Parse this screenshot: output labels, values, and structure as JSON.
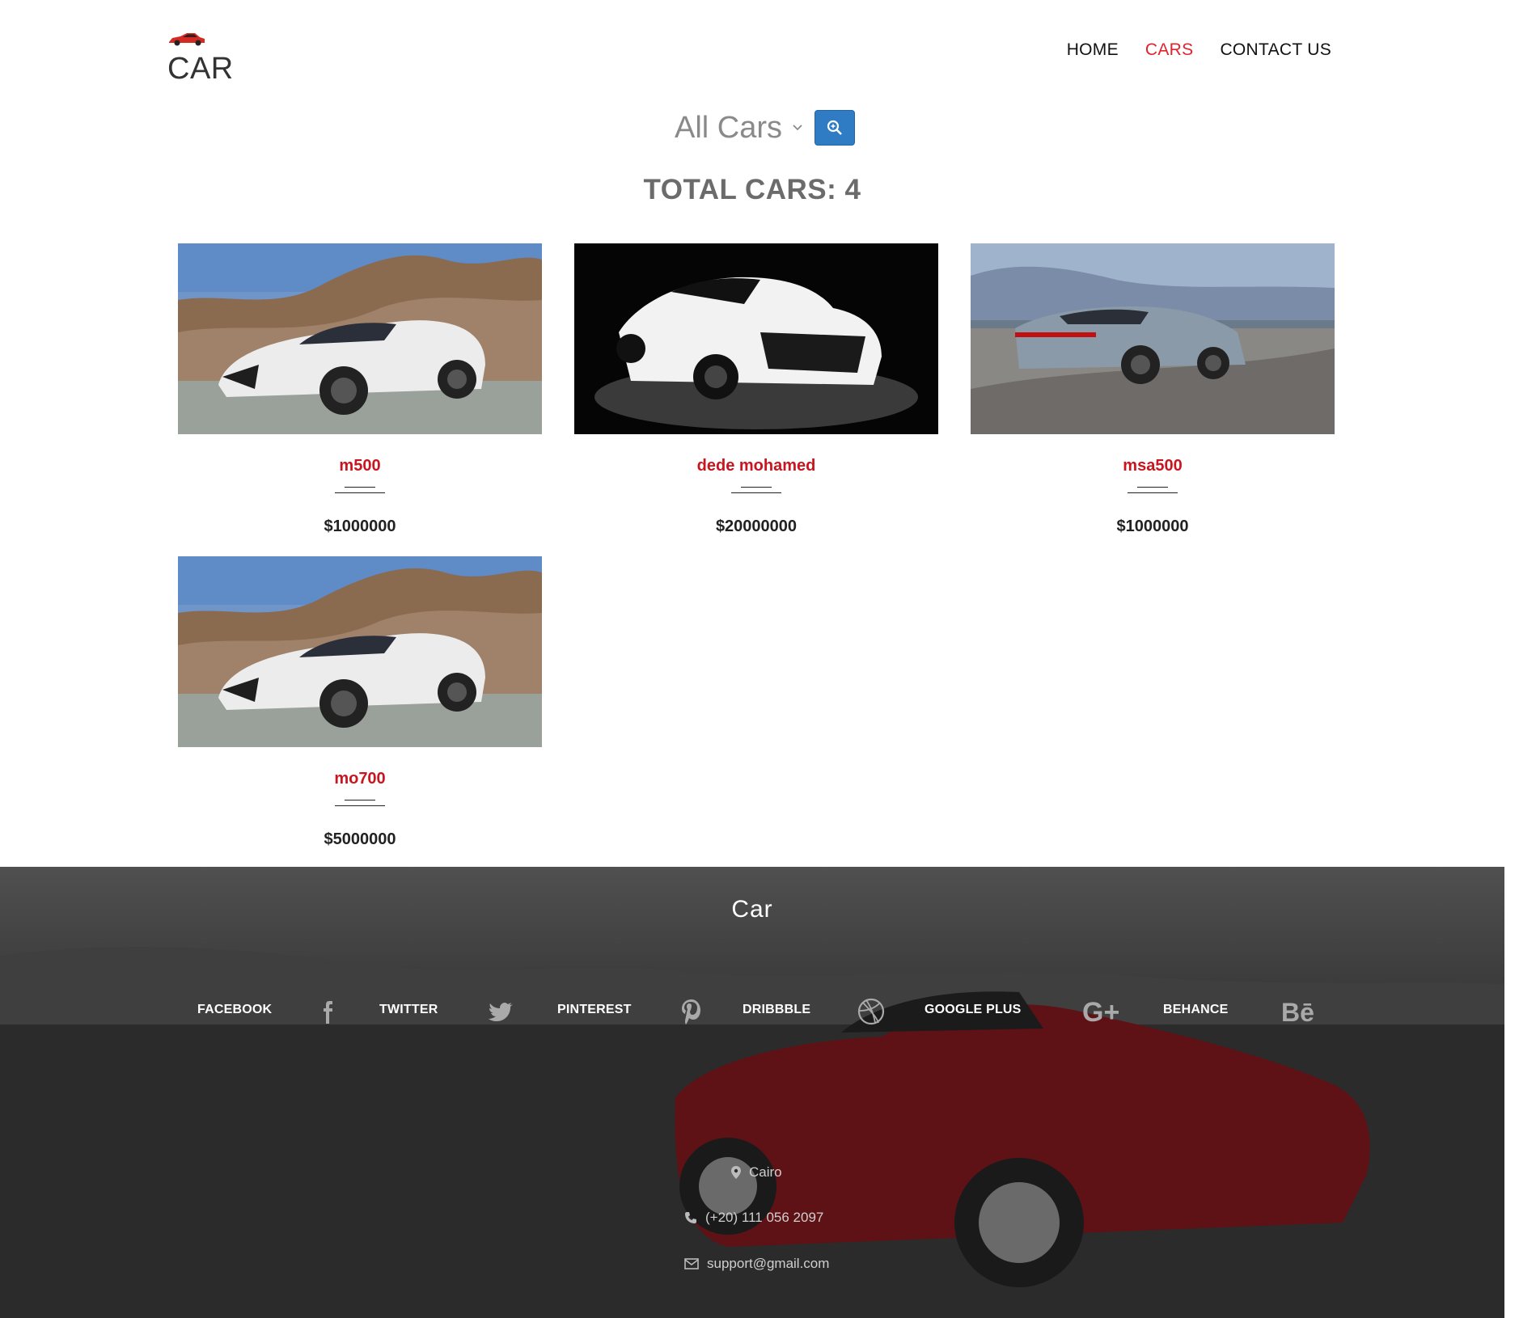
{
  "brand": {
    "name": "CAR",
    "logo_icon": "red-car-icon"
  },
  "nav": {
    "items": [
      {
        "label": "HOME",
        "active": false
      },
      {
        "label": "CARS",
        "active": true
      },
      {
        "label": "CONTACT US",
        "active": false
      }
    ],
    "active_color": "#e1232f"
  },
  "filter": {
    "selected": "All Cars",
    "search_icon": "search-zoom-icon",
    "button_color": "#2f7bc4"
  },
  "total_label": "TOTAL CARS: 4",
  "cars": [
    {
      "name": "m500",
      "price": "$1000000",
      "image": "white-supercar-desert"
    },
    {
      "name": "dede mohamed",
      "price": "$20000000",
      "image": "white-supercar-studio"
    },
    {
      "name": "msa500",
      "price": "$1000000",
      "image": "gray-supercar-track"
    },
    {
      "name": "mo700",
      "price": "$5000000",
      "image": "white-supercar-desert"
    }
  ],
  "name_color": "#c9151f",
  "footer": {
    "title": "Car",
    "social": [
      {
        "label": "FACEBOOK",
        "icon": "facebook-icon"
      },
      {
        "label": "TWITTER",
        "icon": "twitter-icon"
      },
      {
        "label": "PINTEREST",
        "icon": "pinterest-icon"
      },
      {
        "label": "DRIBBBLE",
        "icon": "dribbble-icon"
      },
      {
        "label": "GOOGLE PLUS",
        "icon": "google-plus-icon"
      },
      {
        "label": "BEHANCE",
        "icon": "behance-icon"
      }
    ],
    "contact": {
      "location": "Cairo",
      "phone": "(+20) 111 056 2097",
      "email": "support@gmail.com"
    }
  }
}
